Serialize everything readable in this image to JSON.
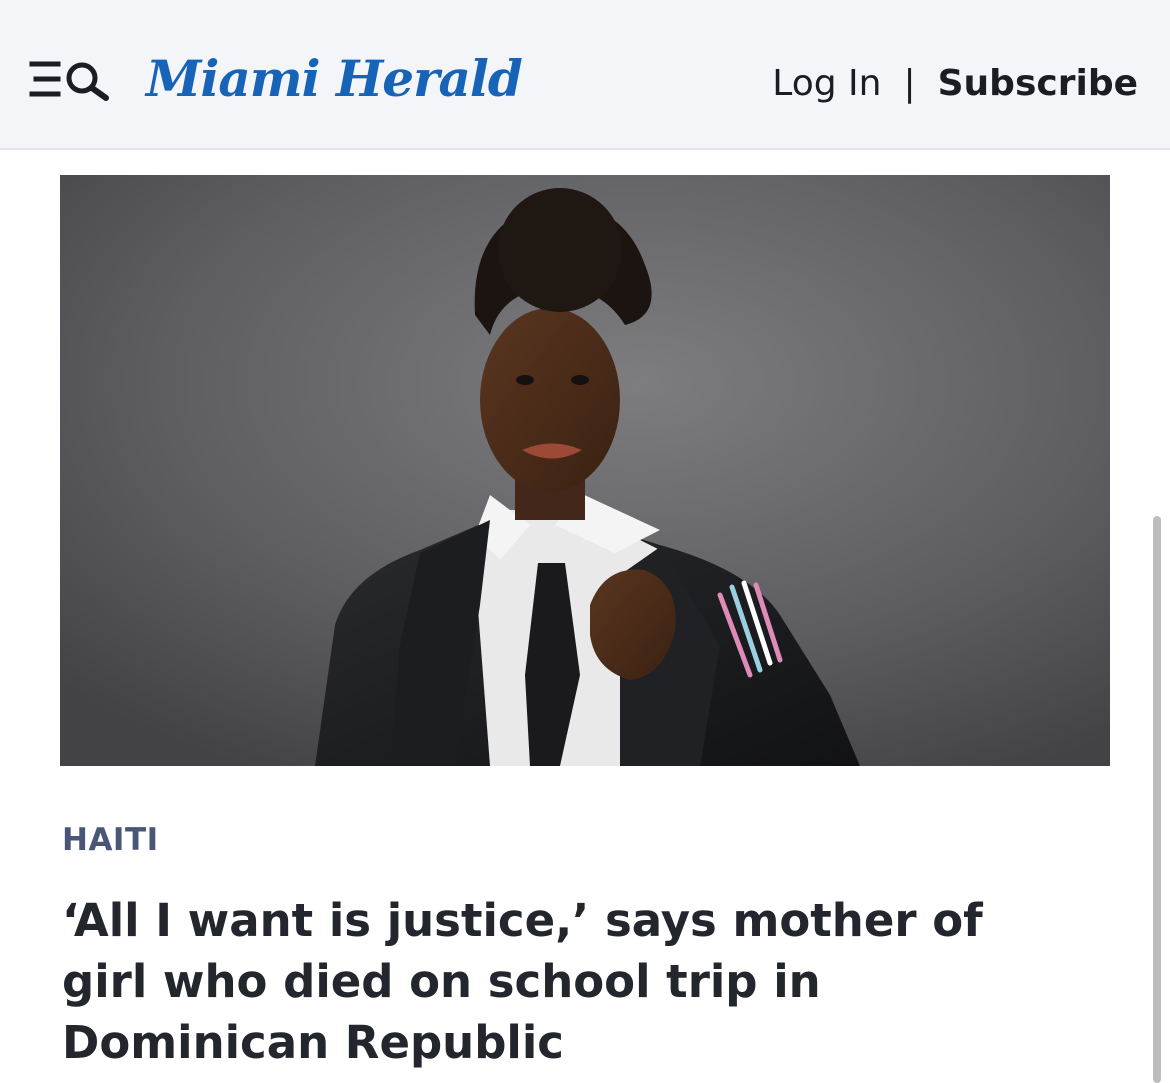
{
  "header": {
    "logo_text": "Miami Herald",
    "login_label": "Log In",
    "separator": "|",
    "subscribe_label": "Subscribe",
    "menu_icon": "menu-search-icon"
  },
  "article": {
    "image_subject": "lead-photo",
    "section": "HAITI",
    "headline": "‘All I want is justice,’ says mother of girl who died on school trip in Dominican Republic"
  },
  "colors": {
    "brand": "#1763b8",
    "header_bg": "#f4f5f8",
    "kicker": "#4a5677",
    "headline": "#23262d"
  }
}
